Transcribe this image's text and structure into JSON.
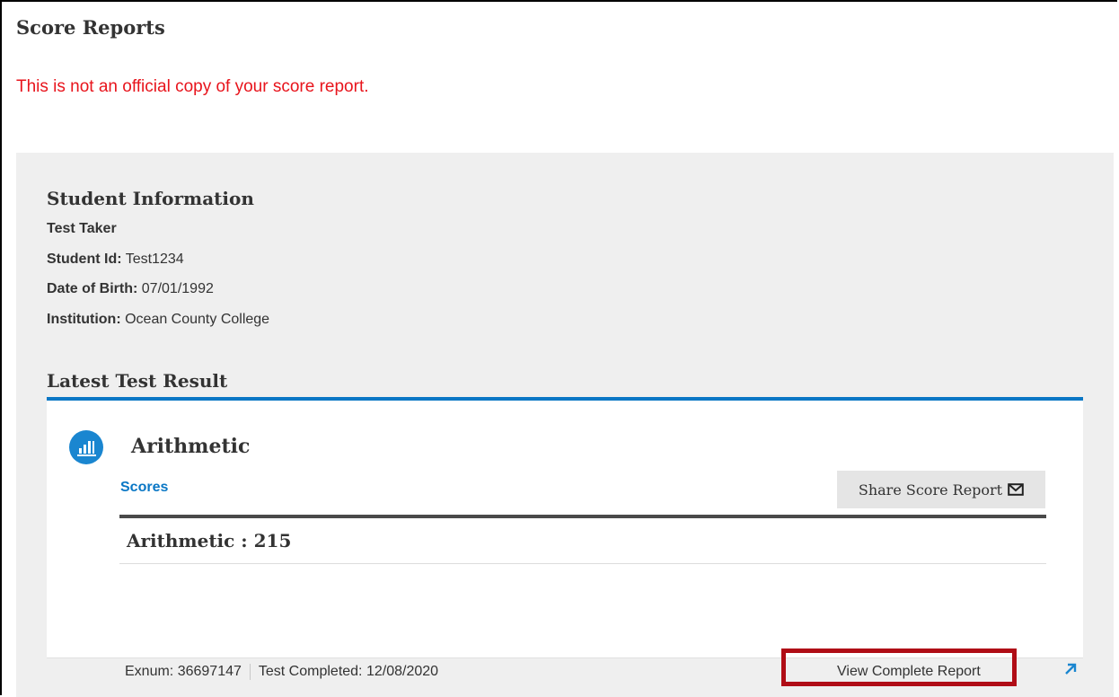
{
  "page": {
    "title": "Score Reports",
    "disclaimer": "This is not an official copy of your score report."
  },
  "student_information": {
    "heading": "Student Information",
    "name": "Test Taker",
    "student_id_label": "Student Id:",
    "student_id": "Test1234",
    "dob_label": "Date of Birth:",
    "dob": "07/01/1992",
    "institution_label": "Institution:",
    "institution": "Ocean County College"
  },
  "latest_result": {
    "heading": "Latest Test Result",
    "test_icon": "bar-chart-icon",
    "test_name": "Arithmetic",
    "scores_link": "Scores",
    "share_button": "Share Score Report",
    "share_icon": "envelope-icon",
    "score_text": "Arithmetic : 215",
    "exnum_label": "Exnum:",
    "exnum": "36697147",
    "completed_label": "Test Completed:",
    "completed_date": "12/08/2020",
    "view_report": "View Complete Report",
    "view_report_icon": "external-link-icon"
  },
  "colors": {
    "accent_blue": "#0a77c5",
    "disclaimer_red": "#e8141c",
    "highlight_border": "#b00d16",
    "panel_grey": "#efefef"
  }
}
